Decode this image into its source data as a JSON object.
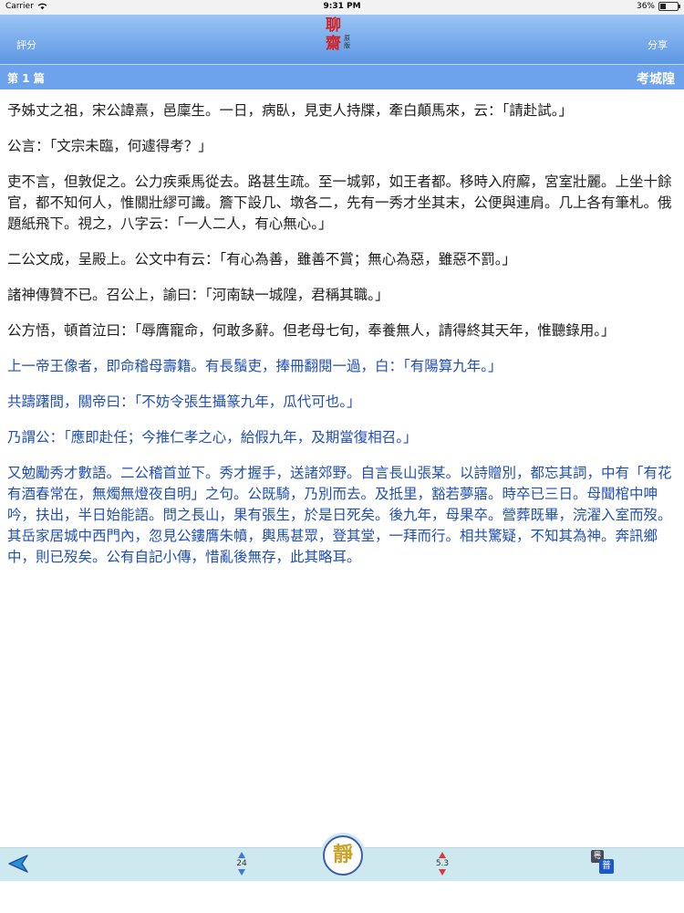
{
  "status_bar": {
    "carrier": "Carrier",
    "time": "9:31 PM",
    "battery": "36%"
  },
  "nav": {
    "left_label": "評分",
    "right_label": "分享",
    "logo_char_1": "聊",
    "logo_char_2": "齋",
    "logo_small": "原版",
    "bar_color": "#6da2ec"
  },
  "chapter": {
    "number": "第 1 篇",
    "title": "考城隍"
  },
  "content": {
    "paragraphs": [
      "予姊丈之祖，宋公諱熹，邑廩生。一日，病臥，見吏人持牒，牽白顛馬來，云：「請赴試。」",
      "公言：「文宗未臨，何遽得考？」",
      "吏不言，但敦促之。公力疾乘馬從去。路甚生疏。至一城郭，如王者都。移時入府廨，宮室壯麗。上坐十餘官，都不知何人，惟關壯繆可識。簷下設几、墩各二，先有一秀才坐其末，公便與連肩。几上各有筆札。俄題紙飛下。視之，八字云：「一人二人，有心無心。」",
      "二公文成，呈殿上。公文中有云：「有心為善，雖善不賞；無心為惡，雖惡不罰。」",
      "諸神傳贊不已。召公上，諭曰：「河南缺一城隍，君稱其職。」",
      "公方悟，頓首泣曰：「辱膺寵命，何敢多辭。但老母七旬，奉養無人，請得終其天年，惟聽錄用。」",
      "上一帝王像者，即命稽母壽籍。有長鬚吏，捧冊翻閱一過，白：「有陽算九年。」",
      "共躊躇間，關帝曰：「不妨令張生攝篆九年，瓜代可也。」",
      "乃謂公：「應即赴任；今推仁孝之心，給假九年，及期當復相召。」",
      "又勉勵秀才數語。二公稽首並下。秀才握手，送諸郊野。自言長山張某。以詩贈別，都忘其詞，中有「有花有酒春常在，無燭無燈夜自明」之句。公既騎，乃別而去。及抵里，豁若夢寤。時卒已三日。母聞棺中呻吟，扶出，半日始能語。問之長山，果有張生，於是日死矣。後九年，母果卒。營葬既畢，浣濯入室而歿。其岳家居城中西門內，忽見公鏤膺朱幩，輿馬甚眾，登其堂，一拜而行。相共驚疑，不知其為神。奔訊鄉中，則已歿矣。公有自記小傳，惜亂後無存，此其略耳。"
    ]
  },
  "toolbar": {
    "stepper_a_value": "24",
    "stepper_b_value": "5.3",
    "mode_char": "靜",
    "fontset_char_1": "粵",
    "fontset_char_2": "普"
  }
}
